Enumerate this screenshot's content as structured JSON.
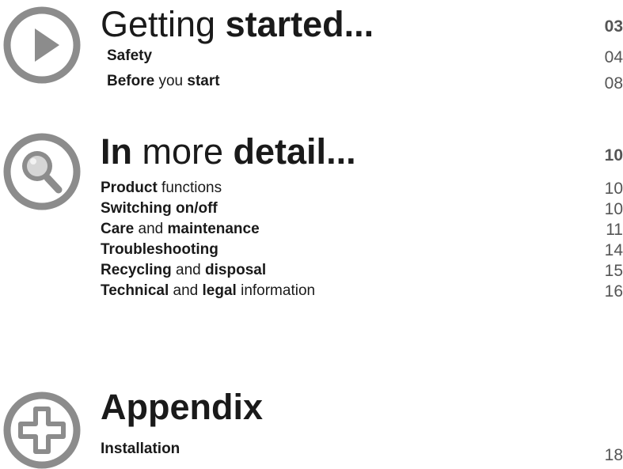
{
  "sections": [
    {
      "heading": [
        {
          "t": "Getting ",
          "b": false
        },
        {
          "t": "started...",
          "b": true
        }
      ],
      "page": "03",
      "icon": "play-icon",
      "entries": [
        {
          "runs": [
            {
              "t": "Safety",
              "b": true
            }
          ],
          "page": "04"
        },
        {
          "runs": [
            {
              "t": "Before",
              "b": true
            },
            {
              "t": " you ",
              "b": false
            },
            {
              "t": "start",
              "b": true
            }
          ],
          "page": "08"
        }
      ]
    },
    {
      "heading": [
        {
          "t": "In",
          "b": true
        },
        {
          "t": " more ",
          "b": false
        },
        {
          "t": "detail...",
          "b": true
        }
      ],
      "page": "10",
      "icon": "magnifier-icon",
      "entries": [
        {
          "runs": [
            {
              "t": "Product",
              "b": true
            },
            {
              "t": " functions",
              "b": false
            }
          ],
          "page": "10"
        },
        {
          "runs": [
            {
              "t": "Switching on/off",
              "b": true
            }
          ],
          "page": "10"
        },
        {
          "runs": [
            {
              "t": "Care",
              "b": true
            },
            {
              "t": " and ",
              "b": false
            },
            {
              "t": "maintenance",
              "b": true
            }
          ],
          "page": "11"
        },
        {
          "runs": [
            {
              "t": "Troubleshooting",
              "b": true
            }
          ],
          "page": "14"
        },
        {
          "runs": [
            {
              "t": "Recycling",
              "b": true
            },
            {
              "t": " and ",
              "b": false
            },
            {
              "t": "disposal",
              "b": true
            }
          ],
          "page": "15"
        },
        {
          "runs": [
            {
              "t": "Technical",
              "b": true
            },
            {
              "t": " and ",
              "b": false
            },
            {
              "t": "legal",
              "b": true
            },
            {
              "t": " information",
              "b": false
            }
          ],
          "page": "16"
        }
      ]
    },
    {
      "heading": [
        {
          "t": "Appendix",
          "b": true
        }
      ],
      "page": "",
      "icon": "plus-icon",
      "entries": [
        {
          "runs": [
            {
              "t": "Installation",
              "b": true
            }
          ],
          "page": "18"
        }
      ]
    }
  ],
  "colors": {
    "icon_gray": "#8c8c8c",
    "text": "#1a1a1a",
    "page_number": "#555555"
  }
}
